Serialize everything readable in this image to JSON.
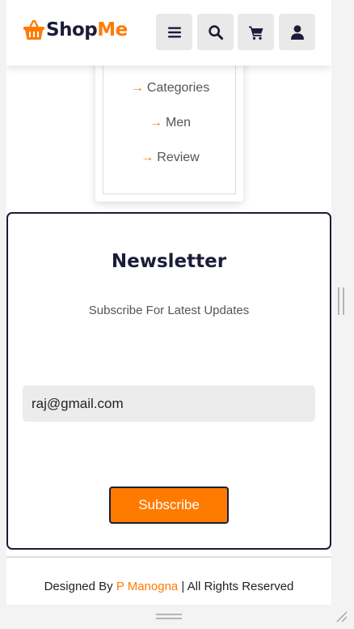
{
  "header": {
    "logo_part1": "Shop",
    "logo_part2": "Me",
    "buttons": [
      {
        "name": "menu",
        "icon": "hamburger-icon"
      },
      {
        "name": "search",
        "icon": "search-icon"
      },
      {
        "name": "cart",
        "icon": "cart-icon"
      },
      {
        "name": "user",
        "icon": "user-icon"
      }
    ]
  },
  "menu": {
    "items": [
      {
        "arrow": "→",
        "label": "Categories"
      },
      {
        "arrow": "→",
        "label": "Men"
      },
      {
        "arrow": "→",
        "label": "Review"
      }
    ]
  },
  "newsletter": {
    "title": "Newsletter",
    "subtitle": "Subscribe For Latest Updates",
    "email_value": "raj@gmail.com",
    "button_label": "Subscribe"
  },
  "footer": {
    "prefix": "Designed By ",
    "author": "P Manogna",
    "suffix": " | All Rights Reserved"
  },
  "colors": {
    "accent": "#ff7b00",
    "dark": "#1c1c3a",
    "button_bg": "#e9e9e9"
  }
}
